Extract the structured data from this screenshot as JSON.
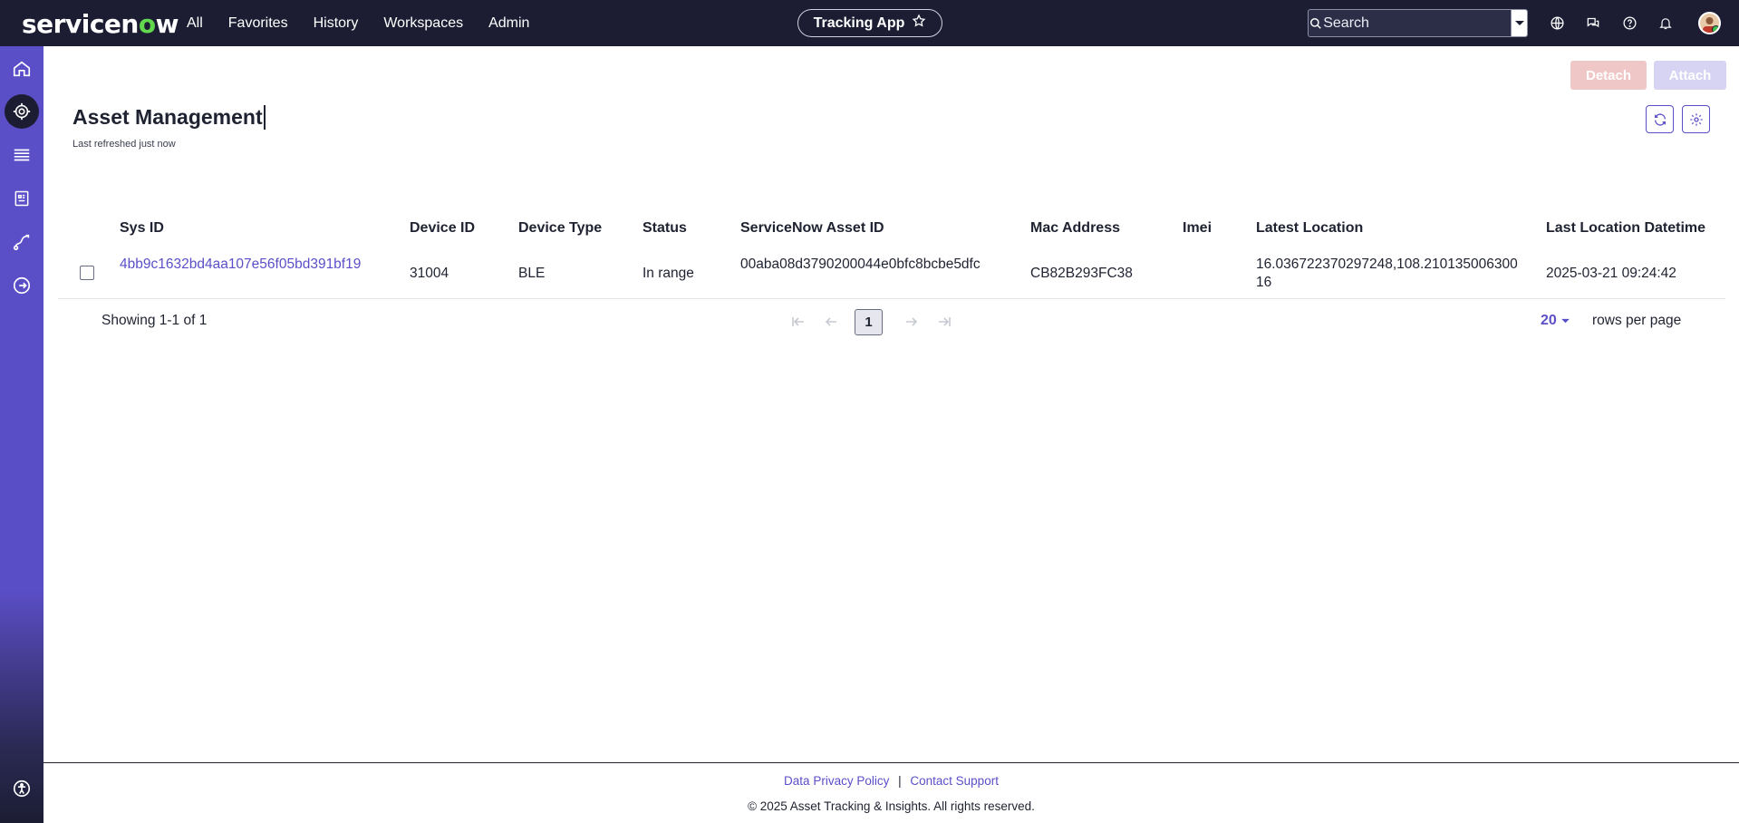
{
  "brand": {
    "logo_text_a": "servicen",
    "logo_text_o": "o",
    "logo_text_b": "w"
  },
  "nav": {
    "items": [
      "All",
      "Favorites",
      "History",
      "Workspaces",
      "Admin"
    ]
  },
  "app_pill": {
    "label": "Tracking App"
  },
  "search": {
    "placeholder": "Search"
  },
  "toolbar": {
    "detach_label": "Detach",
    "attach_label": "Attach"
  },
  "page": {
    "title": "Asset Management",
    "refreshed": "Last refreshed just now"
  },
  "table": {
    "columns": [
      "Sys ID",
      "Device ID",
      "Device Type",
      "Status",
      "ServiceNow Asset ID",
      "Mac Address",
      "Imei",
      "Latest Location",
      "Last Location Datetime"
    ],
    "rows": [
      {
        "sys_id": "4bb9c1632bd4aa107e56f05bd391bf19",
        "device_id": "31004",
        "device_type": "BLE",
        "status": "In range",
        "asset_id": "00aba08d3790200044e0bfc8bcbe5dfc",
        "mac": "CB82B293FC38",
        "imei": "",
        "location": "16.036722370297248,108.21013500630016",
        "datetime": "2025-03-21 09:24:42"
      }
    ]
  },
  "pagination": {
    "showing": "Showing 1-1 of 1",
    "current_page": "1",
    "rows_per_page_value": "20",
    "rows_per_page_label": "rows per page"
  },
  "footer": {
    "privacy": "Data Privacy Policy",
    "separator": "|",
    "support": "Contact Support",
    "copyright": "© 2025 Asset Tracking & Insights. All rights reserved."
  },
  "colors": {
    "nav_bg": "#1c1d33",
    "accent": "#5b4fc8",
    "sidebar": "#5a4ec6",
    "brand_green": "#62d84e"
  }
}
